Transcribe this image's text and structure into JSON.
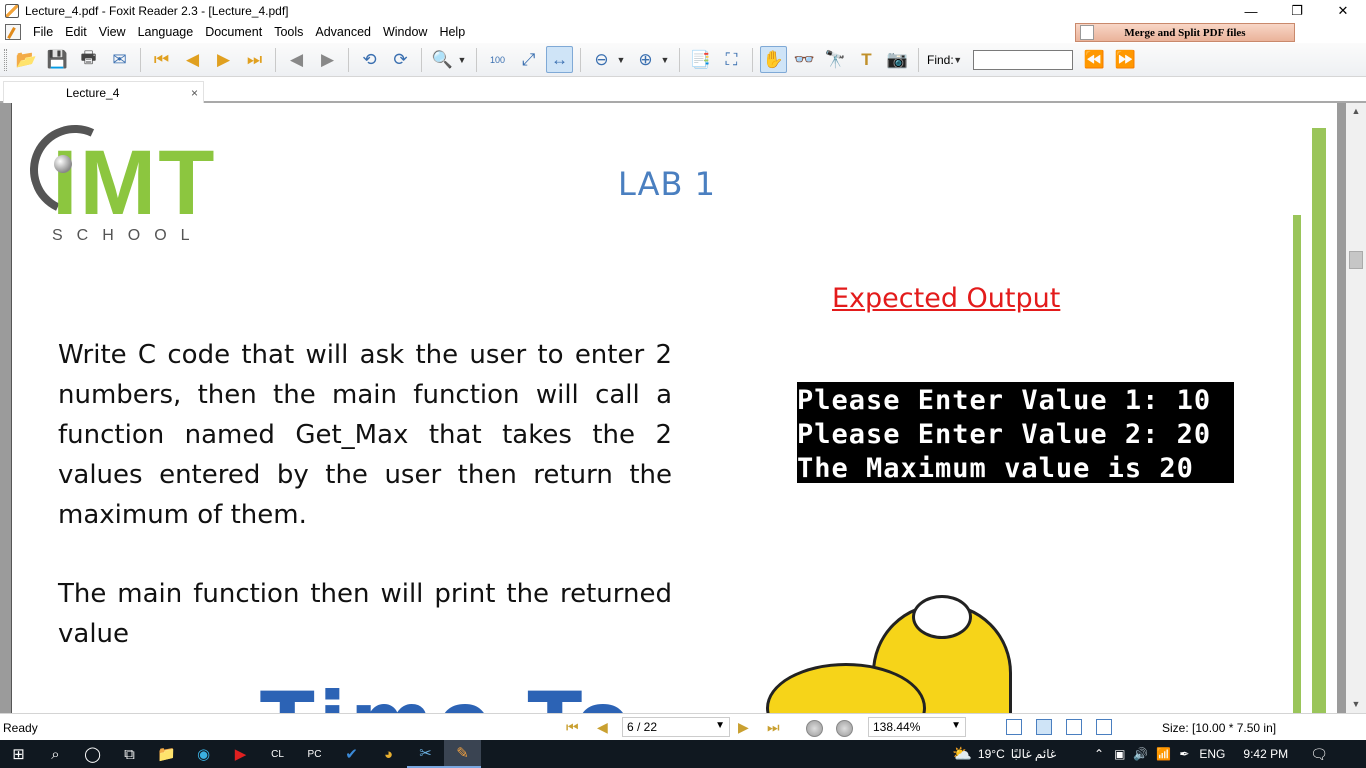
{
  "window": {
    "title": "Lecture_4.pdf - Foxit Reader 2.3 - [Lecture_4.pdf]",
    "minimize": "—",
    "restore": "❐",
    "close": "✕"
  },
  "menu": [
    "File",
    "Edit",
    "View",
    "Language",
    "Document",
    "Tools",
    "Advanced",
    "Window",
    "Help"
  ],
  "merge_button": "Merge and Split PDF files",
  "toolbar": {
    "find_label": "Find:",
    "find_value": ""
  },
  "tab": {
    "label": "Lecture_4",
    "close": "×"
  },
  "document": {
    "logo_text": "IMT",
    "logo_sub": "SCHOOL",
    "lab_title": "LAB 1",
    "expected_output_title": "Expected Output",
    "paragraph1": "Write C code that will ask the user to enter 2 numbers, then the main function will call a function named Get_Max that takes the 2 values entered by the user then return the maximum of them.",
    "paragraph2": "The main function then will print the returned value",
    "console_lines": [
      "Please Enter Value 1: 10",
      "Please Enter Value 2: 20",
      "The Maximum value is 20"
    ],
    "bottom_text": "Time To"
  },
  "status": {
    "ready": "Ready",
    "page_indicator": "6 / 22",
    "zoom": "138.44%",
    "size": "Size: [10.00 * 7.50 in]"
  },
  "taskbar": {
    "weather": "19°C",
    "weather_desc": "غائم غالبًا",
    "lang": "ENG",
    "time": "9:42 PM"
  },
  "colors": {
    "logo_green": "#8cc63f",
    "lab_blue": "#4a7fc0",
    "expected_red": "#e31b1b"
  }
}
